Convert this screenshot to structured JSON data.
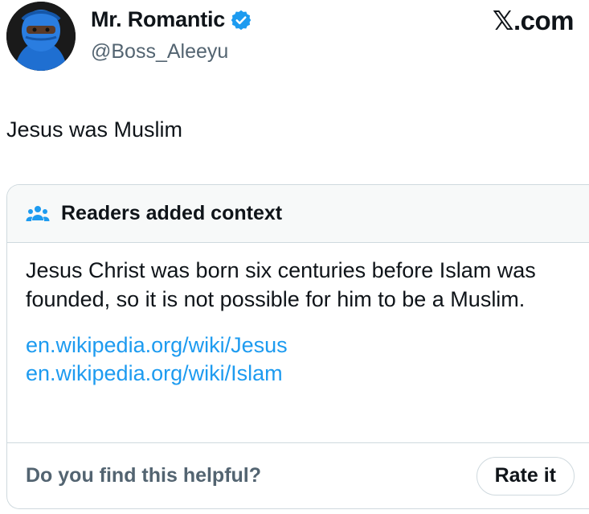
{
  "tweet": {
    "author": {
      "display_name": "Mr. Romantic",
      "handle": "@Boss_Aleeyu",
      "verified": true,
      "avatar_icon": "user-avatar"
    },
    "brand": "𝕏.com",
    "text": "Jesus was Muslim"
  },
  "community_note": {
    "header_icon": "people-icon",
    "title": "Readers added context",
    "body": "Jesus Christ was born six centuries before Islam was founded, so it is not possible for him to be a Muslim.",
    "links": [
      "en.wikipedia.org/wiki/Jesus",
      "en.wikipedia.org/wiki/Islam"
    ],
    "footer_question": "Do you find this helpful?",
    "rate_button_label": "Rate it"
  },
  "colors": {
    "link": "#1d9bf0",
    "verified_badge": "#1d9bf0",
    "note_header_bg": "#f7f9f9",
    "border": "#cfd9de",
    "secondary_text": "#536471"
  }
}
